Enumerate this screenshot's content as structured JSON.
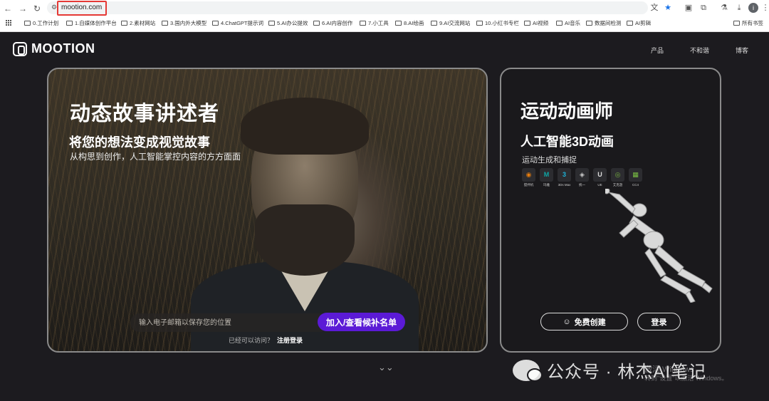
{
  "browser": {
    "url": "mootion.com",
    "bookmarks": [
      "0.工作计划",
      "1.自媒体创作平台",
      "2.素材网站",
      "3.国内外大模型",
      "4.ChatGPT提示词",
      "5.AI办公提效",
      "6.AI内容创作",
      "7.小工具",
      "8.AI绘画",
      "9.AI交流网站",
      "10.小红书专栏",
      "AI视频",
      "AI音乐",
      "数据间检测",
      "AI剪辑",
      "所有书签"
    ]
  },
  "site": {
    "logo": "MOOTION",
    "nav": [
      "产品",
      "不和谐",
      "博客"
    ]
  },
  "left_card": {
    "title": "动态故事讲述者",
    "subtitle": "将您的想法变成视觉故事",
    "description": "从构思到创作，人工智能掌控内容的方方面面",
    "email_placeholder": "输入电子邮箱以保存您的位置",
    "join_button": "加入/查看候补名单",
    "access_text": "已经可以访问？",
    "register_link": "注册登录"
  },
  "right_card": {
    "title": "运动动画师",
    "subtitle": "人工智能3D动画",
    "description": "运动生成和捕捉",
    "tools": [
      {
        "label": "搅拌机",
        "glyph": "◉",
        "color": "#e87d0d"
      },
      {
        "label": "玛雅",
        "glyph": "M",
        "color": "#0fa5a5"
      },
      {
        "label": "3Ds Max",
        "glyph": "3",
        "color": "#1db2d8"
      },
      {
        "label": "统一",
        "glyph": "◈",
        "color": "#cccccc"
      },
      {
        "label": "UE",
        "glyph": "U",
        "color": "#dddddd"
      },
      {
        "label": "艾克遊",
        "glyph": "◎",
        "color": "#76b041"
      },
      {
        "label": "CC4",
        "glyph": "▦",
        "color": "#7ac043"
      }
    ],
    "free_button": "免费创建",
    "login_button": "登录"
  },
  "watermark": {
    "text": "公众号 · 林杰AI笔记",
    "windows_line1": "激活 Windows",
    "windows_line2": "转到\"设置\"以激活 Windows。"
  }
}
